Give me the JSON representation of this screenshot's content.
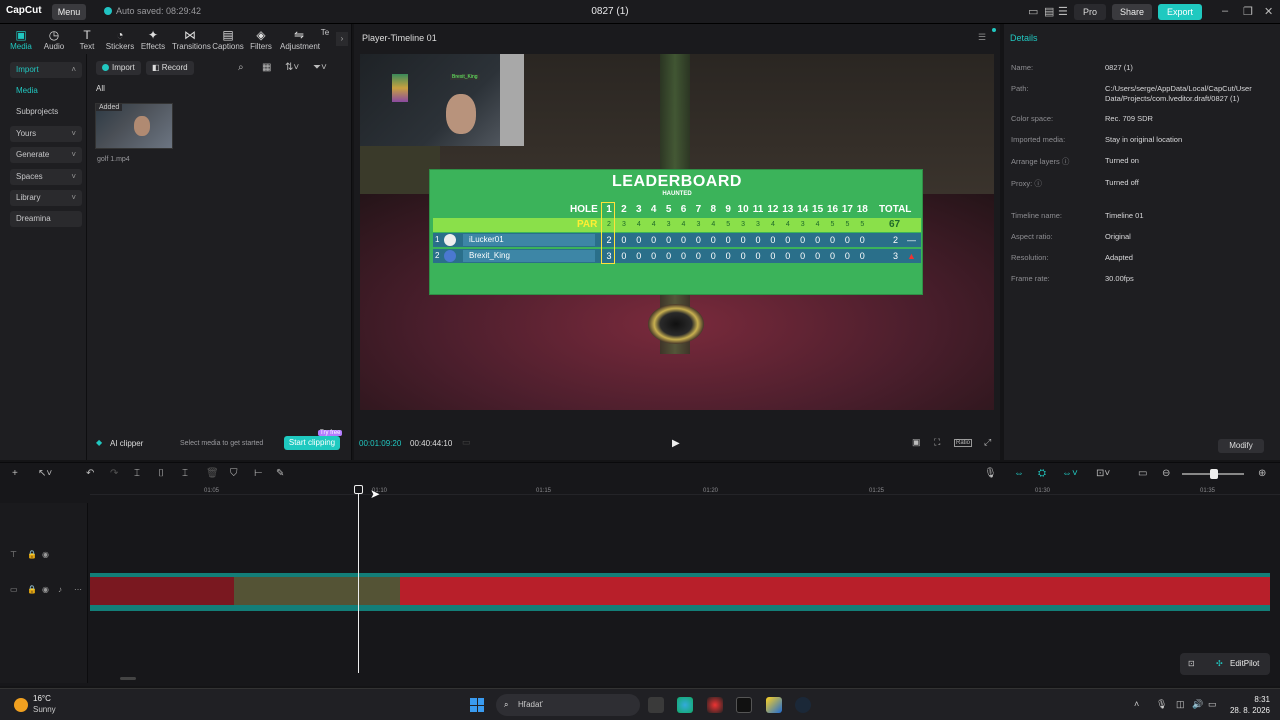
{
  "titlebar": {
    "app_name": "CapCut",
    "menu_label": "Menu",
    "autosave_text": "Auto saved: 08:29:42",
    "project_title": "0827 (1)",
    "pro_label": "Pro",
    "share_label": "Share",
    "export_label": "Export"
  },
  "toolbar": {
    "tabs": [
      {
        "label": "Media",
        "icon": "▣"
      },
      {
        "label": "Audio",
        "icon": "◷"
      },
      {
        "label": "Text",
        "icon": "T"
      },
      {
        "label": "Stickers",
        "icon": "◔"
      },
      {
        "label": "Effects",
        "icon": "✦"
      },
      {
        "label": "Transitions",
        "icon": "⋈"
      },
      {
        "label": "Captions",
        "icon": "▤"
      },
      {
        "label": "Filters",
        "icon": "◈"
      },
      {
        "label": "Adjustment",
        "icon": "⇋"
      },
      {
        "label": "Te",
        "icon": "›"
      }
    ]
  },
  "sidebar": {
    "items": [
      {
        "label": "Import"
      },
      {
        "label": "Media"
      },
      {
        "label": "Subprojects"
      },
      {
        "label": "Yours"
      },
      {
        "label": "Generate"
      },
      {
        "label": "Spaces"
      },
      {
        "label": "Library"
      },
      {
        "label": "Dreamina"
      }
    ]
  },
  "media": {
    "import_label": "Import",
    "record_label": "Record",
    "filter_all": "All",
    "added_badge": "Added",
    "file_name": "golf 1.mp4"
  },
  "clipper": {
    "label": "AI clipper",
    "hint": "Select media to get started",
    "start_label": "Start clipping",
    "badge": "Try free"
  },
  "player": {
    "title": "Player-Timeline 01",
    "current_time": "00:01:09:20",
    "total_time": "00:40:44:10",
    "ratio_label": "Ratio",
    "webcam_tag": "Brexit_King"
  },
  "leaderboard": {
    "title": "LEADERBOARD",
    "subtitle": "HAUNTED",
    "hole_label": "HOLE",
    "total_label": "TOTAL",
    "par_label": "PAR",
    "holes": [
      "1",
      "2",
      "3",
      "4",
      "5",
      "6",
      "7",
      "8",
      "9",
      "10",
      "11",
      "12",
      "13",
      "14",
      "15",
      "16",
      "17",
      "18"
    ],
    "par": [
      "2",
      "2",
      "3",
      "4",
      "4",
      "3",
      "4",
      "3",
      "4",
      "5",
      "3",
      "3",
      "4",
      "4",
      "3",
      "4",
      "5",
      "5",
      "5"
    ],
    "par_values": [
      "2",
      "3",
      "4",
      "4",
      "3",
      "4",
      "3",
      "4",
      "5",
      "3",
      "3",
      "4",
      "4",
      "3",
      "4",
      "5",
      "5",
      "5"
    ],
    "par_total": "67",
    "players": [
      {
        "rank": "1",
        "name": "iLucker01",
        "scores": [
          "2",
          "0",
          "0",
          "0",
          "0",
          "0",
          "0",
          "0",
          "0",
          "0",
          "0",
          "0",
          "0",
          "0",
          "0",
          "0",
          "0",
          "0"
        ],
        "total": "2",
        "delta": "—"
      },
      {
        "rank": "2",
        "name": "Brexit_King",
        "scores": [
          "3",
          "0",
          "0",
          "0",
          "0",
          "0",
          "0",
          "0",
          "0",
          "0",
          "0",
          "0",
          "0",
          "0",
          "0",
          "0",
          "0",
          "0"
        ],
        "total": "3",
        "delta": "▲"
      }
    ]
  },
  "details": {
    "header": "Details",
    "rows": [
      {
        "key": "Name:",
        "value": "0827 (1)"
      },
      {
        "key": "Path:",
        "value": "C:/Users/serge/AppData/Local/CapCut/User Data/Projects/com.lveditor.draft/0827 (1)"
      },
      {
        "key": "Color space:",
        "value": "Rec. 709 SDR"
      },
      {
        "key": "Imported media:",
        "value": "Stay in original location"
      },
      {
        "key": "Arrange layers ⓘ",
        "value": "Turned on"
      },
      {
        "key": "Proxy: ⓘ",
        "value": "Turned off"
      },
      {
        "key": "Timeline name:",
        "value": "Timeline 01"
      },
      {
        "key": "Aspect ratio:",
        "value": "Original"
      },
      {
        "key": "Resolution:",
        "value": "Adapted"
      },
      {
        "key": "Frame rate:",
        "value": "30.00fps"
      }
    ],
    "modify_label": "Modify"
  },
  "timeline": {
    "ruler": [
      "01:05",
      "01:10",
      "01:15",
      "01:20",
      "01:25",
      "01:30",
      "01:35"
    ],
    "editpilot_label": "EditPilot"
  },
  "taskbar": {
    "temperature": "16°C",
    "condition": "Sunny",
    "search_placeholder": "Hľadať",
    "time": "8:31",
    "date": "28. 8. 2026"
  }
}
